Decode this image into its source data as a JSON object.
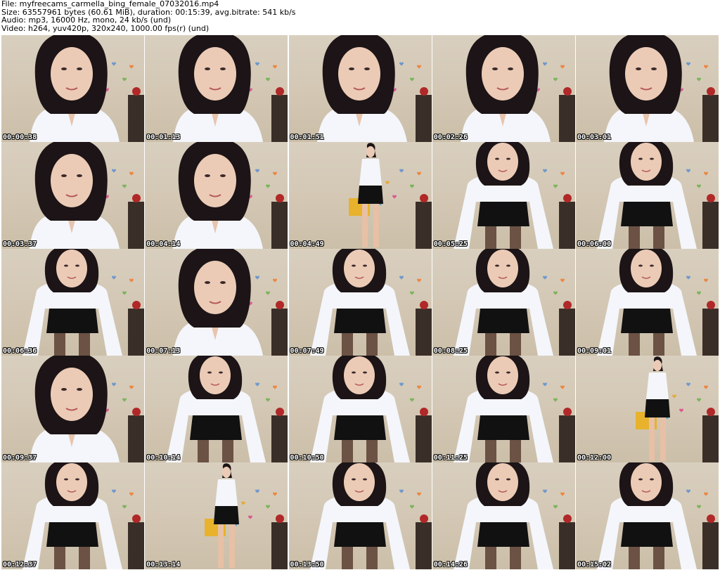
{
  "header": {
    "file": "File: myfreecams_carmella_bing_female_07032016.mp4",
    "size": "Size: 63557961 bytes (60.61 MiB), duration: 00:15:39, avg.bitrate: 541 kb/s",
    "audio": "Audio: mp3, 16000 Hz, mono, 24 kb/s (und)",
    "video": "Video: h264, yuv420p, 320x240, 1000.00 fps(r) (und)"
  },
  "thumbnails": [
    {
      "time": "00:00:38",
      "pose": "face"
    },
    {
      "time": "00:01:13",
      "pose": "face"
    },
    {
      "time": "00:01:51",
      "pose": "face"
    },
    {
      "time": "00:02:26",
      "pose": "face"
    },
    {
      "time": "00:03:01",
      "pose": "face"
    },
    {
      "time": "00:03:37",
      "pose": "face"
    },
    {
      "time": "00:04:14",
      "pose": "face"
    },
    {
      "time": "00:04:49",
      "pose": "standing"
    },
    {
      "time": "00:05:25",
      "pose": "lean"
    },
    {
      "time": "00:06:00",
      "pose": "lean"
    },
    {
      "time": "00:06:36",
      "pose": "lean"
    },
    {
      "time": "00:07:13",
      "pose": "face"
    },
    {
      "time": "00:07:49",
      "pose": "lean"
    },
    {
      "time": "00:08:25",
      "pose": "lean"
    },
    {
      "time": "00:09:01",
      "pose": "lean"
    },
    {
      "time": "00:09:37",
      "pose": "face"
    },
    {
      "time": "00:10:14",
      "pose": "lean"
    },
    {
      "time": "00:10:50",
      "pose": "lean"
    },
    {
      "time": "00:11:25",
      "pose": "lean"
    },
    {
      "time": "00:12:00",
      "pose": "standing"
    },
    {
      "time": "00:12:37",
      "pose": "lean"
    },
    {
      "time": "00:13:14",
      "pose": "standing"
    },
    {
      "time": "00:13:50",
      "pose": "lean"
    },
    {
      "time": "00:14:26",
      "pose": "lean"
    },
    {
      "time": "00:15:02",
      "pose": "lean"
    }
  ]
}
